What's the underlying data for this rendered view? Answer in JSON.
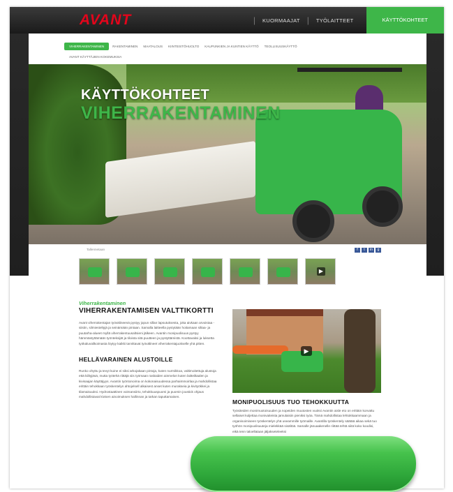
{
  "brand": {
    "logo": "AVANT"
  },
  "top_nav": {
    "items": [
      "KUORMAAJAT",
      "TYÖLAITTEET"
    ],
    "active": "KÄYTTÖKOHTEET"
  },
  "sub_nav": {
    "active": "VIHERRAKENTAMINEN",
    "items": [
      "RAKENTAMINEN",
      "MAATALOUS",
      "KIINTEISTÖHUOLTO",
      "KAUPUNKIEN JA KUNTIEN KÄYTTÖ",
      "TEOLLISUUSKÄYTTÖ"
    ],
    "second_row": "AVANT KÄYTTÄJIEN KOKEMUKSIA"
  },
  "hero": {
    "title": "KÄYTTÖKOHTEET",
    "subtitle": "VIHERRAKENTAMINEN"
  },
  "gallery": {
    "label": "Tallennetaan",
    "social": [
      "f",
      "t",
      "in",
      "g"
    ],
    "thumbs": [
      {
        "icon": "tractor-icon"
      },
      {
        "icon": "tractor-icon"
      },
      {
        "icon": "tractor-icon"
      },
      {
        "icon": "tractor-icon"
      },
      {
        "icon": "tractor-icon"
      },
      {
        "icon": "tractor-icon"
      },
      {
        "icon": "play-icon"
      }
    ]
  },
  "content": {
    "kicker": "Viherrakentaminen",
    "heading": "VIHERRAKENTAMISEN VALTTIKORTTI",
    "intro": "Avant viherrakentajan työvälineenä pystyy jopun sillan lapsutuksesta, joka aivkaan arvoistaa - siistin, silmiesteltyjä ja seinämään pintaan. Samalla laitteella pystytään hoitamaan siltaa- ja puutarha-alueet myllä viherrakentuusaltsieni jälkeen. Avantin monipuolisuus pystyy hämmästyttämään työnteksijät ja tiloista sitä puutteen ja pystyttämistä. Koottavaksi ja luksetta työkaluvalikoimasta löytyy kaikki tarvittavat työvälineet viherrakentajuokselle yhä pitten.",
    "heading2": "HELLÄVARAINEN ALUSTOILLE",
    "para2": "Runko ohyttu ja tevyt kuine ei siksi arkojakaan pintoja, kuten nurmikkoa, valtimoitettuja alustoja että kiiltyjäsä, mutta työtehä riittäjä siis työmaan raskaiden ainmelon kuten laitteiltaalen ja kivisaajan käyttäjyys. Avantin työntonoima on kokonaisuudessa parhaimmoirlaa ja mahdollistaa erittäin tehokkaan työskentelyn ahtojelsell alkaisest anset kuten murakseia ja kivityökkei ja tilamaisuuksi. Hydrostaattinen voimansiirto, tehokkuuspuomi ja puomin joustick ohjaus mahdollistavat kivisen ainoimuksen hallinnan ja tarkan taputtamaisen.",
    "heading3": "MONIPUOLISUUS TUO TEHOKKUUTTA",
    "para3": "Työsiteiden monimuotoisuuden ja nopeiden muutosten vuoksi Avantin aisle eto on erittäin korvattu sellaiset kuljettaa monivaiteista jamulaisiin pieniksi työa. Tämä mahdollistaa lehtokkaammaan ja organisoimiseen työskentelyn yhä useammille työmaille. Avantilla työskentely säätää aikaa sekä tuo työhön monipuolisuuteja mielekkää sisältöä. Samalle jänuaakenelle riittää tehtä siitä koko koodisi, eikä tenn taloellataan jäljakseteleeksi"
  }
}
